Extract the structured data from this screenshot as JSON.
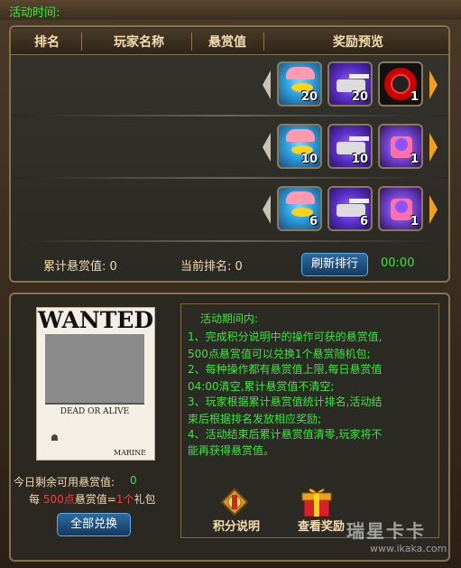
{
  "top": {
    "event_time_label": "活动时间:"
  },
  "header": {
    "rank": "排名",
    "player_name": "玩家名称",
    "bounty": "悬赏值",
    "reward_preview": "奖励预览"
  },
  "reward_rows": [
    {
      "items": [
        {
          "icon": "duck-captain-icon",
          "qty": "20"
        },
        {
          "icon": "tank-icon",
          "qty": "20"
        },
        {
          "icon": "target-icon",
          "qty": "1"
        }
      ]
    },
    {
      "items": [
        {
          "icon": "duck-captain-icon",
          "qty": "10"
        },
        {
          "icon": "tank-icon",
          "qty": "10"
        },
        {
          "icon": "gift-orb-icon",
          "qty": "1"
        }
      ]
    },
    {
      "items": [
        {
          "icon": "duck-captain-icon",
          "qty": "6"
        },
        {
          "icon": "tank-icon",
          "qty": "6"
        },
        {
          "icon": "gift-orb-icon",
          "qty": "1"
        }
      ]
    }
  ],
  "summary": {
    "total_bounty_label": "累计悬赏值:",
    "total_bounty_value": "0",
    "current_rank_label": "当前排名:",
    "current_rank_value": "0",
    "refresh_label": "刷新排行",
    "timer": "00:00"
  },
  "poster": {
    "title": "WANTED",
    "subtitle": "DEAD OR ALIVE",
    "footer": "MARINE"
  },
  "remaining": {
    "label": "今日剩余可用悬赏值:",
    "value": "0"
  },
  "rate": {
    "prefix": "每",
    "points": "500点",
    "middle": "悬赏值=",
    "count": "1个",
    "suffix": "礼包"
  },
  "exchange_all_label": "全部兑换",
  "rules": [
    "活动期间内:",
    "1、完成积分说明中的操作可获的悬赏值,",
    "500点悬赏值可以兑换1个悬赏随机包;",
    "2、每种操作都有悬赏值上限,每日悬赏值",
    "04:00清空,累计悬赏值不清空;",
    "3、玩家根据累计悬赏值统计排名,活动结",
    "束后根据排名发放相应奖励;",
    "4、活动结束后累计悬赏值清零,玩家将不",
    "能再获得悬赏值。"
  ],
  "buttons": {
    "points_help": "积分说明",
    "view_rewards": "查看奖励"
  },
  "watermark": {
    "brand": "瑞星卡卡",
    "url": "www.ikaka.com"
  },
  "colors": {
    "accent_green": "#39e83a",
    "text_tan": "#f6dcae",
    "highlight_red": "#ff3a3a"
  }
}
